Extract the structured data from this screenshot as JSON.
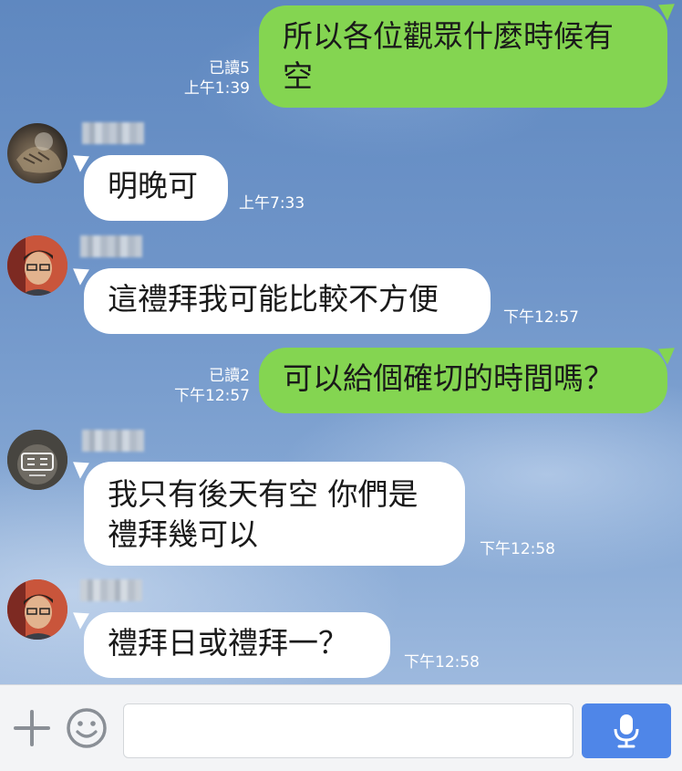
{
  "messages": [
    {
      "from": "me",
      "text": [
        "所以各位觀眾什麼時候有",
        "空"
      ],
      "read": "已讀5",
      "time": "上午1:39"
    },
    {
      "from": "them",
      "text": [
        "明晚可"
      ],
      "time": "上午7:33"
    },
    {
      "from": "them",
      "text": [
        "這禮拜我可能比較不方便"
      ],
      "time": "下午12:57"
    },
    {
      "from": "me",
      "text": [
        "可以給個確切的時間嗎？"
      ],
      "read": "已讀2",
      "time": "下午12:57"
    },
    {
      "from": "them",
      "text": [
        "我只有後天有空 你們是",
        "禮拜幾可以"
      ],
      "time": "下午12:58"
    },
    {
      "from": "them",
      "text": [
        "禮拜日或禮拜一？"
      ],
      "time": "下午12:58"
    }
  ],
  "input": {
    "value": "",
    "placeholder": ""
  },
  "icons": {
    "plus": "plus-icon",
    "emoji": "smiley-icon",
    "mic": "microphone-icon"
  },
  "colors": {
    "my_bubble": "#84d551",
    "their_bubble": "#ffffff",
    "mic_button": "#4f86e8"
  }
}
